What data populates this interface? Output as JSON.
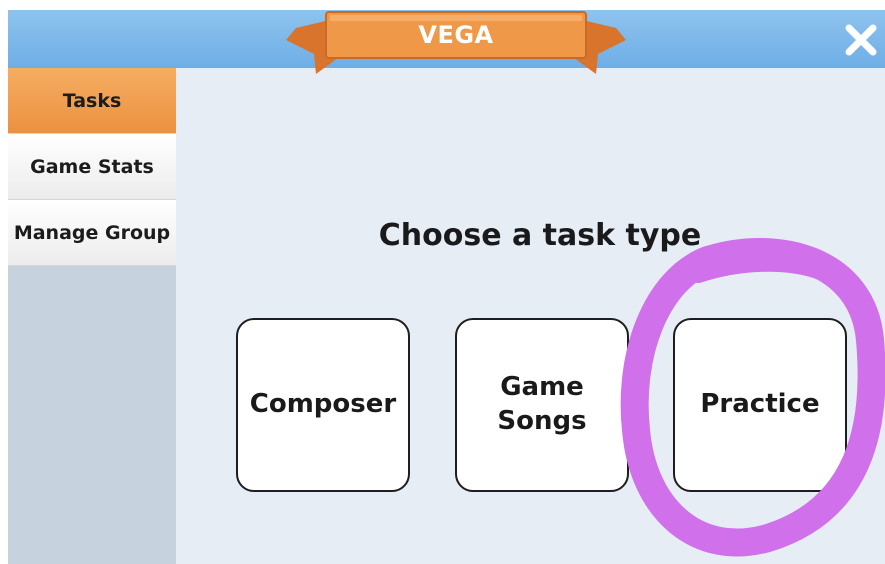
{
  "header": {
    "title": "VEGA",
    "close_icon": "close-icon"
  },
  "sidebar": {
    "items": [
      {
        "label": "Tasks",
        "active": true
      },
      {
        "label": "Game Stats",
        "active": false
      },
      {
        "label": "Manage Group",
        "active": false
      }
    ]
  },
  "main": {
    "prompt": "Choose a task type",
    "task_types": [
      {
        "label": "Composer"
      },
      {
        "label": "Game Songs"
      },
      {
        "label": "Practice",
        "highlighted": true
      }
    ]
  },
  "colors": {
    "header_blue": "#7ab6ea",
    "banner_orange": "#ef9848",
    "active_tab_orange": "#f0a050",
    "annotation_purple": "#d070ea",
    "background": "#e6edf5",
    "sidebar_fill": "#c6d2de"
  }
}
